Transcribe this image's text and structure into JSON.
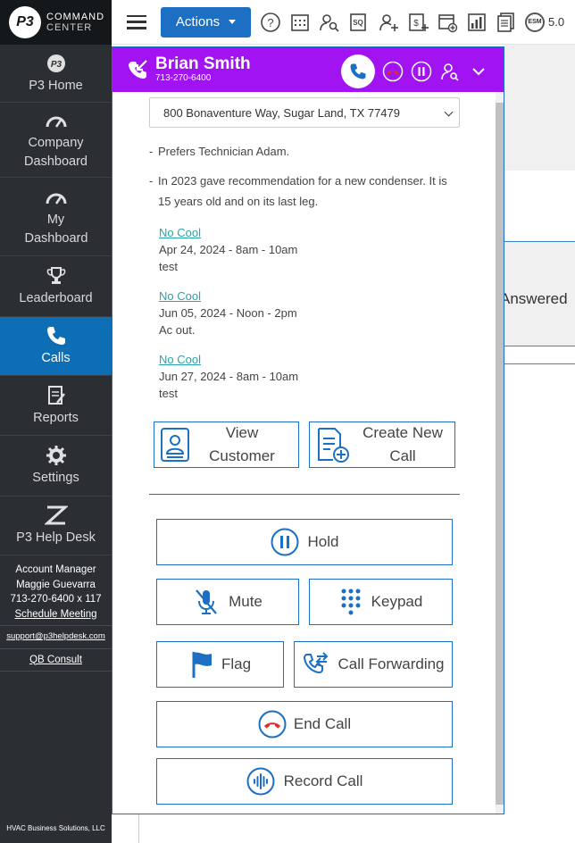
{
  "sidebar": {
    "logo": {
      "badge": "P3",
      "line1": "COMMAND",
      "line2": "CENTER"
    },
    "items": [
      {
        "label": "P3 Home"
      },
      {
        "label": "Company Dashboard"
      },
      {
        "label": "My Dashboard"
      },
      {
        "label": "Leaderboard"
      },
      {
        "label": "Calls"
      },
      {
        "label": "Reports"
      },
      {
        "label": "Settings"
      },
      {
        "label": "P3 Help Desk"
      }
    ],
    "account": {
      "title": "Account Manager",
      "name": "Maggie Guevarra",
      "phone": "713-270-6400 x 117",
      "schedule": "Schedule Meeting",
      "email": "support@p3helpdesk.com",
      "qb": "QB Consult"
    },
    "footer": "HVAC Business Solutions, LLC"
  },
  "topbar": {
    "actions_label": "Actions",
    "esm_label": "ESM",
    "version": "5.0"
  },
  "background": {
    "answered": "Answered"
  },
  "call": {
    "caller_name": "Brian Smith",
    "caller_phone": "713-270-6400",
    "address": "800 Bonaventure Way, Sugar Land, TX 77479",
    "notes": [
      "Prefers Technician Adam.",
      "In 2023 gave recommendation for a new condenser. It is 15 years old and on its last leg."
    ],
    "jobs": [
      {
        "type": "No Cool",
        "date": "Apr 24, 2024 - 8am - 10am",
        "desc": "test"
      },
      {
        "type": "No Cool",
        "date": "Jun 05, 2024 - Noon - 2pm",
        "desc": "Ac out."
      },
      {
        "type": "No Cool",
        "date": "Jun 27, 2024 - 8am - 10am",
        "desc": "test"
      }
    ],
    "buttons": {
      "view_customer": "View Customer",
      "create_call": "Create New Call",
      "hold": "Hold",
      "mute": "Mute",
      "keypad": "Keypad",
      "flag": "Flag",
      "forwarding": "Call Forwarding",
      "end_call": "End Call",
      "record": "Record Call"
    },
    "colors": {
      "header": "#a113f1",
      "accent": "#1d6fc4",
      "end": "#d9302e"
    }
  }
}
